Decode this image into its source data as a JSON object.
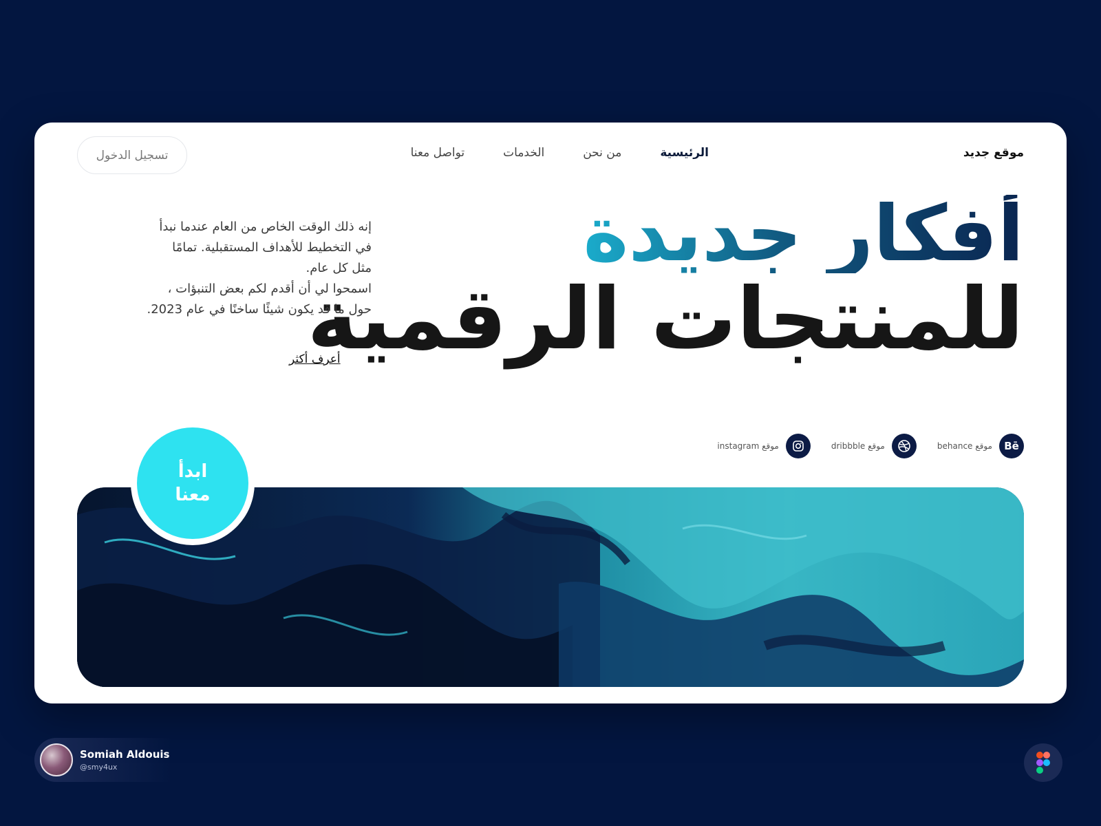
{
  "header": {
    "brand": "موقع جديد",
    "nav": [
      "الرئيسية",
      "من نحن",
      "الخدمات",
      "تواصل معنا"
    ],
    "login": "تسجيل الدخول"
  },
  "hero": {
    "title_line1": "أفكار جديدة",
    "title_line2": "للمنتجات الرقمية",
    "paragraph": [
      "إنه ذلك الوقت الخاص من العام عندما نبدأ",
      "في التخطيط للأهداف المستقبلية. تمامًا",
      "مثل كل عام.",
      "اسمحوا لي أن أقدم لكم بعض التنبؤات ،",
      "حول ما قد يكون شيئًا ساخنًا في عام 2023."
    ],
    "learn_more": "أعرف أكثر",
    "cta_line1": "ابدأ",
    "cta_line2": "معنا"
  },
  "socials": [
    {
      "icon": "behance-icon",
      "glyph": "Bē",
      "label": "موقع behance"
    },
    {
      "icon": "dribbble-icon",
      "glyph": "◎",
      "label": "موقع dribbble"
    },
    {
      "icon": "instagram-icon",
      "glyph": "◻",
      "label": "موقع instagram"
    }
  ],
  "author": {
    "name": "Somiah Aldouis",
    "handle": "@smy4ux"
  },
  "colors": {
    "background": "#031640",
    "accent": "#2ee2f0",
    "navy": "#0c1b45"
  }
}
